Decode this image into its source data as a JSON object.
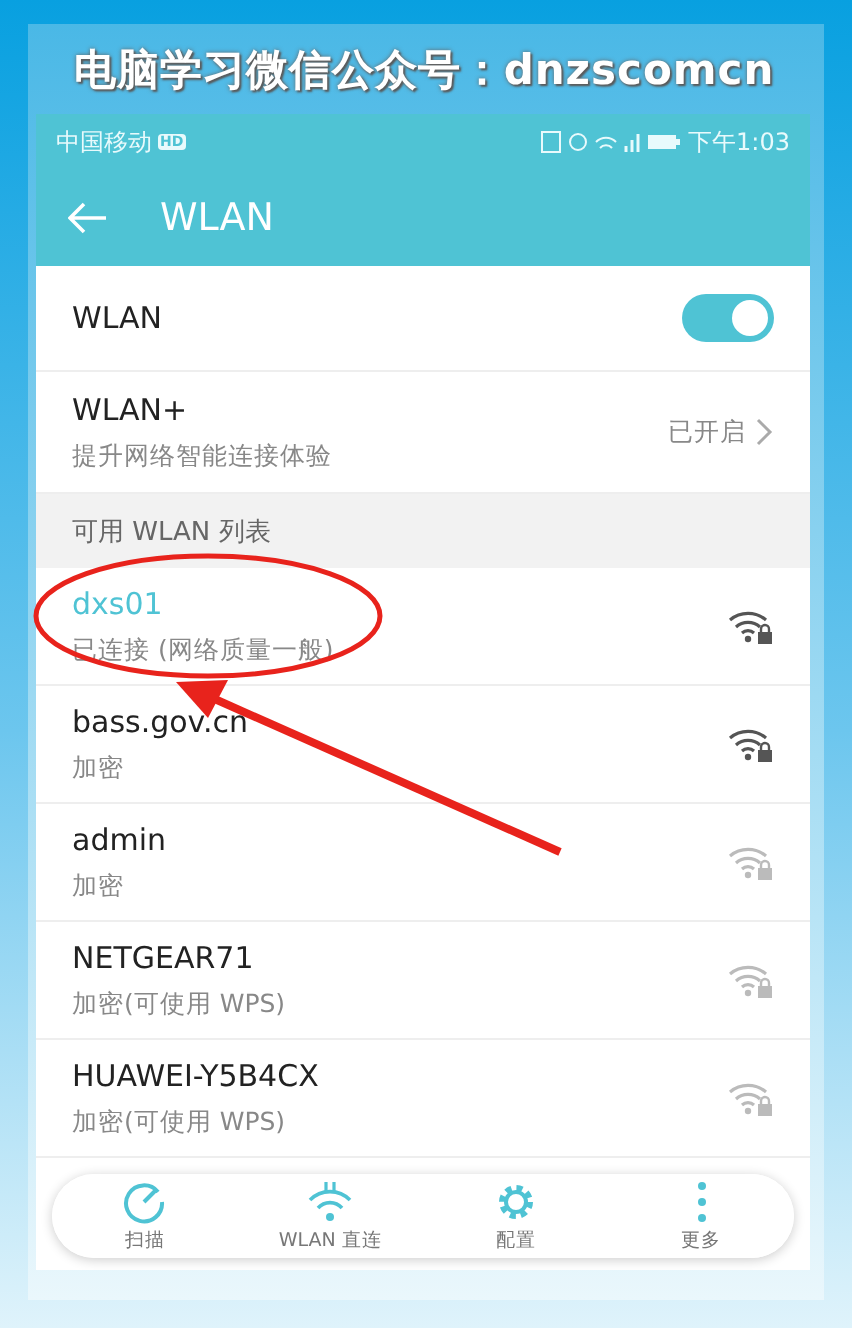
{
  "banner": {
    "title": "电脑学习微信公众号：dnzscomcn"
  },
  "status_bar": {
    "carrier": "中国移动",
    "badge": "HD",
    "time": "下午1:03"
  },
  "app_bar": {
    "title": "WLAN"
  },
  "wlan_switch": {
    "label": "WLAN",
    "on": true
  },
  "wlan_plus": {
    "title": "WLAN+",
    "subtitle": "提升网络智能连接体验",
    "value": "已开启"
  },
  "section_header": "可用 WLAN 列表",
  "networks": [
    {
      "name": "dxs01",
      "status": "已连接 (网络质量一般)",
      "selected": true
    },
    {
      "name": "bass.gov.cn",
      "status": "加密",
      "selected": false
    },
    {
      "name": "admin",
      "status": "加密",
      "selected": false
    },
    {
      "name": "NETGEAR71",
      "status": "加密(可使用 WPS)",
      "selected": false
    },
    {
      "name": "HUAWEI-Y5B4CX",
      "status": "加密(可使用 WPS)",
      "selected": false
    }
  ],
  "toolbar": [
    {
      "kind": "scan",
      "label": "扫描"
    },
    {
      "kind": "direct",
      "label": "WLAN 直连"
    },
    {
      "kind": "config",
      "label": "配置"
    },
    {
      "kind": "more",
      "label": "更多"
    }
  ]
}
